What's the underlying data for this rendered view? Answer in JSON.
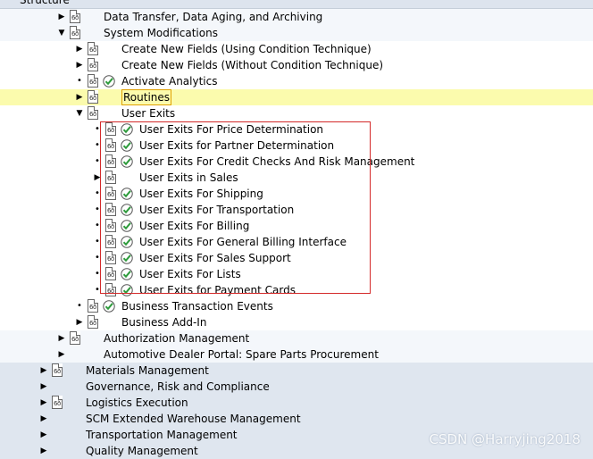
{
  "header": {
    "label": "Structure"
  },
  "watermark": "CSDN @Harryjing2018",
  "colors": {
    "band_l1": "#f4f7fb",
    "band_l0": "#dfe6ef",
    "highlight": "#fbfbad",
    "annotation": "#d42a2a"
  },
  "rows": [
    {
      "label": "Data Transfer, Data Aging, and Archiving",
      "level": 1,
      "expander": "collapsed",
      "doc": true,
      "check": false
    },
    {
      "label": "System Modifications",
      "level": 1,
      "expander": "expanded",
      "doc": true,
      "check": false
    },
    {
      "label": "Create New Fields (Using Condition Technique)",
      "level": 2,
      "expander": "collapsed",
      "doc": true,
      "check": false
    },
    {
      "label": "Create New Fields (Without Condition Technique)",
      "level": 2,
      "expander": "collapsed",
      "doc": true,
      "check": false
    },
    {
      "label": "Activate Analytics",
      "level": 2,
      "expander": "leaf",
      "doc": true,
      "check": true
    },
    {
      "label": "Routines",
      "level": 2,
      "expander": "collapsed",
      "doc": true,
      "check": false,
      "highlight": true
    },
    {
      "label": "User Exits",
      "level": 2,
      "expander": "expanded",
      "doc": true,
      "check": false
    },
    {
      "label": "User Exits For Price Determination",
      "level": 3,
      "expander": "leaf",
      "doc": true,
      "check": true
    },
    {
      "label": "User Exits for Partner Determination",
      "level": 3,
      "expander": "leaf",
      "doc": true,
      "check": true
    },
    {
      "label": "User Exits For Credit Checks And Risk Management",
      "level": 3,
      "expander": "leaf",
      "doc": true,
      "check": true
    },
    {
      "label": "User Exits in Sales",
      "level": 3,
      "expander": "collapsed",
      "doc": true,
      "check": false
    },
    {
      "label": "User Exits For Shipping",
      "level": 3,
      "expander": "leaf",
      "doc": true,
      "check": true
    },
    {
      "label": "User Exits For Transportation",
      "level": 3,
      "expander": "leaf",
      "doc": true,
      "check": true
    },
    {
      "label": "User Exits For Billing",
      "level": 3,
      "expander": "leaf",
      "doc": true,
      "check": true
    },
    {
      "label": "User Exits For General Billing Interface",
      "level": 3,
      "expander": "leaf",
      "doc": true,
      "check": true
    },
    {
      "label": "User Exits For Sales Support",
      "level": 3,
      "expander": "leaf",
      "doc": true,
      "check": true
    },
    {
      "label": "User Exits For Lists",
      "level": 3,
      "expander": "leaf",
      "doc": true,
      "check": true
    },
    {
      "label": "User Exits for Payment Cards",
      "level": 3,
      "expander": "leaf",
      "doc": true,
      "check": true
    },
    {
      "label": "Business Transaction Events",
      "level": 2,
      "expander": "leaf",
      "doc": true,
      "check": true
    },
    {
      "label": "Business Add-In",
      "level": 2,
      "expander": "collapsed",
      "doc": true,
      "check": false
    },
    {
      "label": "Authorization Management",
      "level": 1,
      "expander": "collapsed",
      "doc": true,
      "check": false
    },
    {
      "label": "Automotive Dealer Portal: Spare Parts Procurement",
      "level": 1,
      "expander": "collapsed",
      "doc": false,
      "check": false
    },
    {
      "label": "Materials Management",
      "level": 0,
      "expander": "collapsed",
      "doc": true,
      "check": false
    },
    {
      "label": "Governance, Risk and Compliance",
      "level": 0,
      "expander": "collapsed",
      "doc": false,
      "check": false
    },
    {
      "label": "Logistics Execution",
      "level": 0,
      "expander": "collapsed",
      "doc": true,
      "check": false
    },
    {
      "label": "SCM Extended Warehouse Management",
      "level": 0,
      "expander": "collapsed",
      "doc": false,
      "check": false
    },
    {
      "label": "Transportation Management",
      "level": 0,
      "expander": "collapsed",
      "doc": false,
      "check": false
    },
    {
      "label": "Quality Management",
      "level": 0,
      "expander": "collapsed",
      "doc": false,
      "check": false
    }
  ]
}
